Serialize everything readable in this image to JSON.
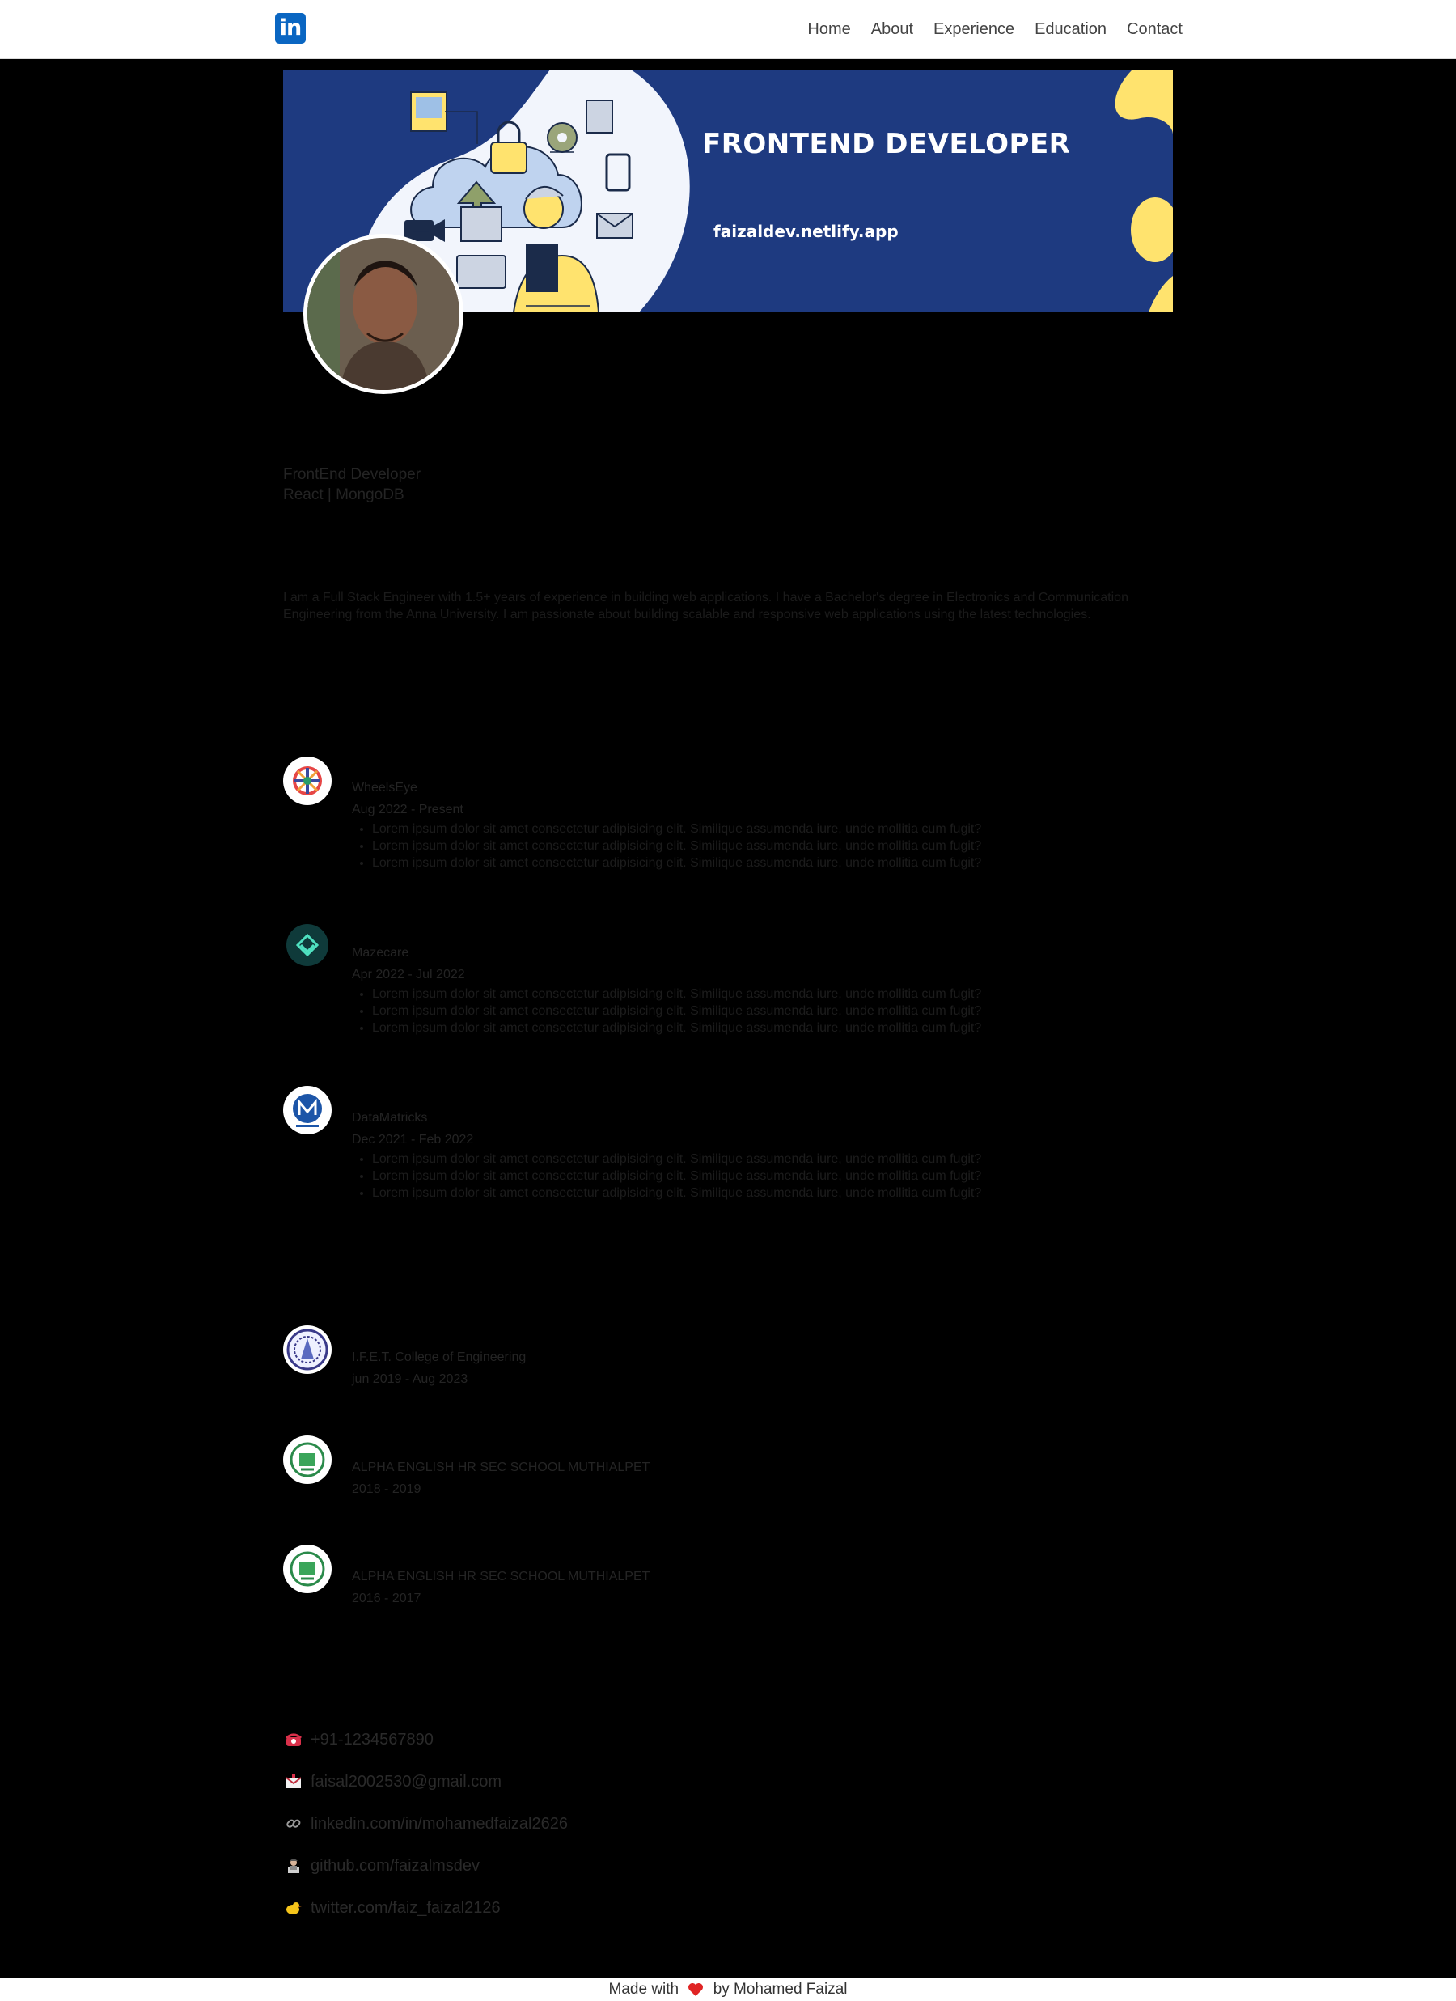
{
  "nav": {
    "logo_text": "in",
    "links": [
      "Home",
      "About",
      "Experience",
      "Education",
      "Contact"
    ]
  },
  "banner": {
    "title": "FRONTEND DEVELOPER",
    "url": "faizaldev.netlify.app"
  },
  "profile": {
    "role": "FrontEnd Developer",
    "stack": "React | MongoDB"
  },
  "about": {
    "text": "I am a Full Stack Engineer with 1.5+ years of experience in building web applications. I have a Bachelor's degree in Electronics and Communication Engineering from the Anna University. I am passionate about building scalable and responsive web applications using the latest technologies."
  },
  "experience": [
    {
      "company": "WheelsEye",
      "period": "Aug 2022 - Present",
      "points": [
        "Lorem ipsum dolor sit amet consectetur adipisicing elit. Similique assumenda iure, unde mollitia cum fugit?",
        "Lorem ipsum dolor sit amet consectetur adipisicing elit. Similique assumenda iure, unde mollitia cum fugit?",
        "Lorem ipsum dolor sit amet consectetur adipisicing elit. Similique assumenda iure, unde mollitia cum fugit?"
      ]
    },
    {
      "company": "Mazecare",
      "period": "Apr 2022 - Jul 2022",
      "points": [
        "Lorem ipsum dolor sit amet consectetur adipisicing elit. Similique assumenda iure, unde mollitia cum fugit?",
        "Lorem ipsum dolor sit amet consectetur adipisicing elit. Similique assumenda iure, unde mollitia cum fugit?",
        "Lorem ipsum dolor sit amet consectetur adipisicing elit. Similique assumenda iure, unde mollitia cum fugit?"
      ]
    },
    {
      "company": "DataMatricks",
      "period": "Dec 2021 - Feb 2022",
      "points": [
        "Lorem ipsum dolor sit amet consectetur adipisicing elit. Similique assumenda iure, unde mollitia cum fugit?",
        "Lorem ipsum dolor sit amet consectetur adipisicing elit. Similique assumenda iure, unde mollitia cum fugit?",
        "Lorem ipsum dolor sit amet consectetur adipisicing elit. Similique assumenda iure, unde mollitia cum fugit?"
      ]
    }
  ],
  "education": [
    {
      "school": "I.F.E.T. College of Engineering",
      "period": "jun 2019 - Aug 2023"
    },
    {
      "school": "ALPHA ENGLISH HR SEC SCHOOL MUTHIALPET",
      "period": "2018 - 2019"
    },
    {
      "school": "ALPHA ENGLISH HR SEC SCHOOL MUTHIALPET",
      "period": "2016 - 2017"
    }
  ],
  "contact": {
    "phone": "+91-1234567890",
    "email": "faisal2002530@gmail.com",
    "linkedin": "linkedin.com/in/mohamedfaizal2626",
    "github": "github.com/faizalmsdev",
    "twitter": "twitter.com/faiz_faizal2126"
  },
  "footer": {
    "prefix": "Made with",
    "suffix": "by Mohamed Faizal"
  },
  "colors": {
    "linkedin_blue": "#0a66c2",
    "banner_navy": "#1e3a80",
    "banner_yellow": "#ffe36e",
    "heart_red": "#e02424"
  }
}
